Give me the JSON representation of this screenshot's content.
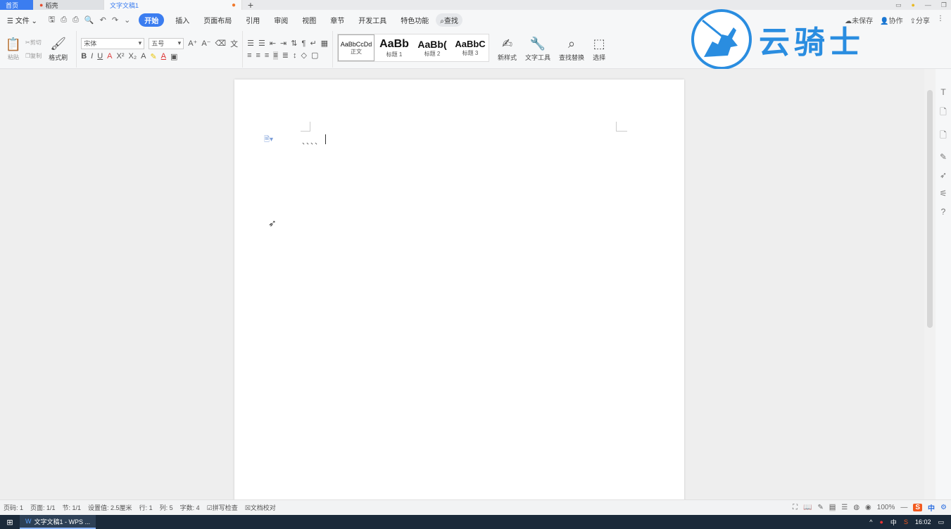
{
  "tabs": {
    "home": "首页",
    "daoke": "稻壳",
    "doc": "文字文稿1",
    "add": "+"
  },
  "menu": {
    "file": "文件",
    "items": [
      "开始",
      "插入",
      "页面布局",
      "引用",
      "审阅",
      "视图",
      "章节",
      "开发工具",
      "特色功能"
    ],
    "search": "查找",
    "unsaved": "未保存",
    "collab": "协作",
    "share": "分享"
  },
  "ribbon": {
    "paste": "粘贴",
    "cut": "剪切",
    "copy": "复制",
    "format_painter": "格式刷",
    "font_name": "宋体",
    "font_size": "五号",
    "styles": [
      {
        "preview": "AaBbCcDd",
        "name": "正文"
      },
      {
        "preview": "AaBb",
        "name": "标题 1"
      },
      {
        "preview": "AaBb(",
        "name": "标题 2"
      },
      {
        "preview": "AaBbC",
        "name": "标题 3"
      }
    ],
    "new_style": "新样式",
    "text_tools": "文字工具",
    "find_replace": "查找替换",
    "select": "选择"
  },
  "watermark": "云骑士",
  "document": {
    "text": "、、、、"
  },
  "status": {
    "page_num": "页码: 1",
    "pages": "页面: 1/1",
    "section": "节: 1/1",
    "setting": "设置值: 2.5厘米",
    "row": "行: 1",
    "col": "列: 5",
    "word_count": "字数: 4",
    "spell": "拼写检查",
    "proof": "文档校对",
    "zoom": "100%",
    "ime": "S",
    "ime_lang": "中"
  },
  "taskbar": {
    "app": "文字文稿1 - WPS ...",
    "ime": "中",
    "time": "16:02"
  }
}
